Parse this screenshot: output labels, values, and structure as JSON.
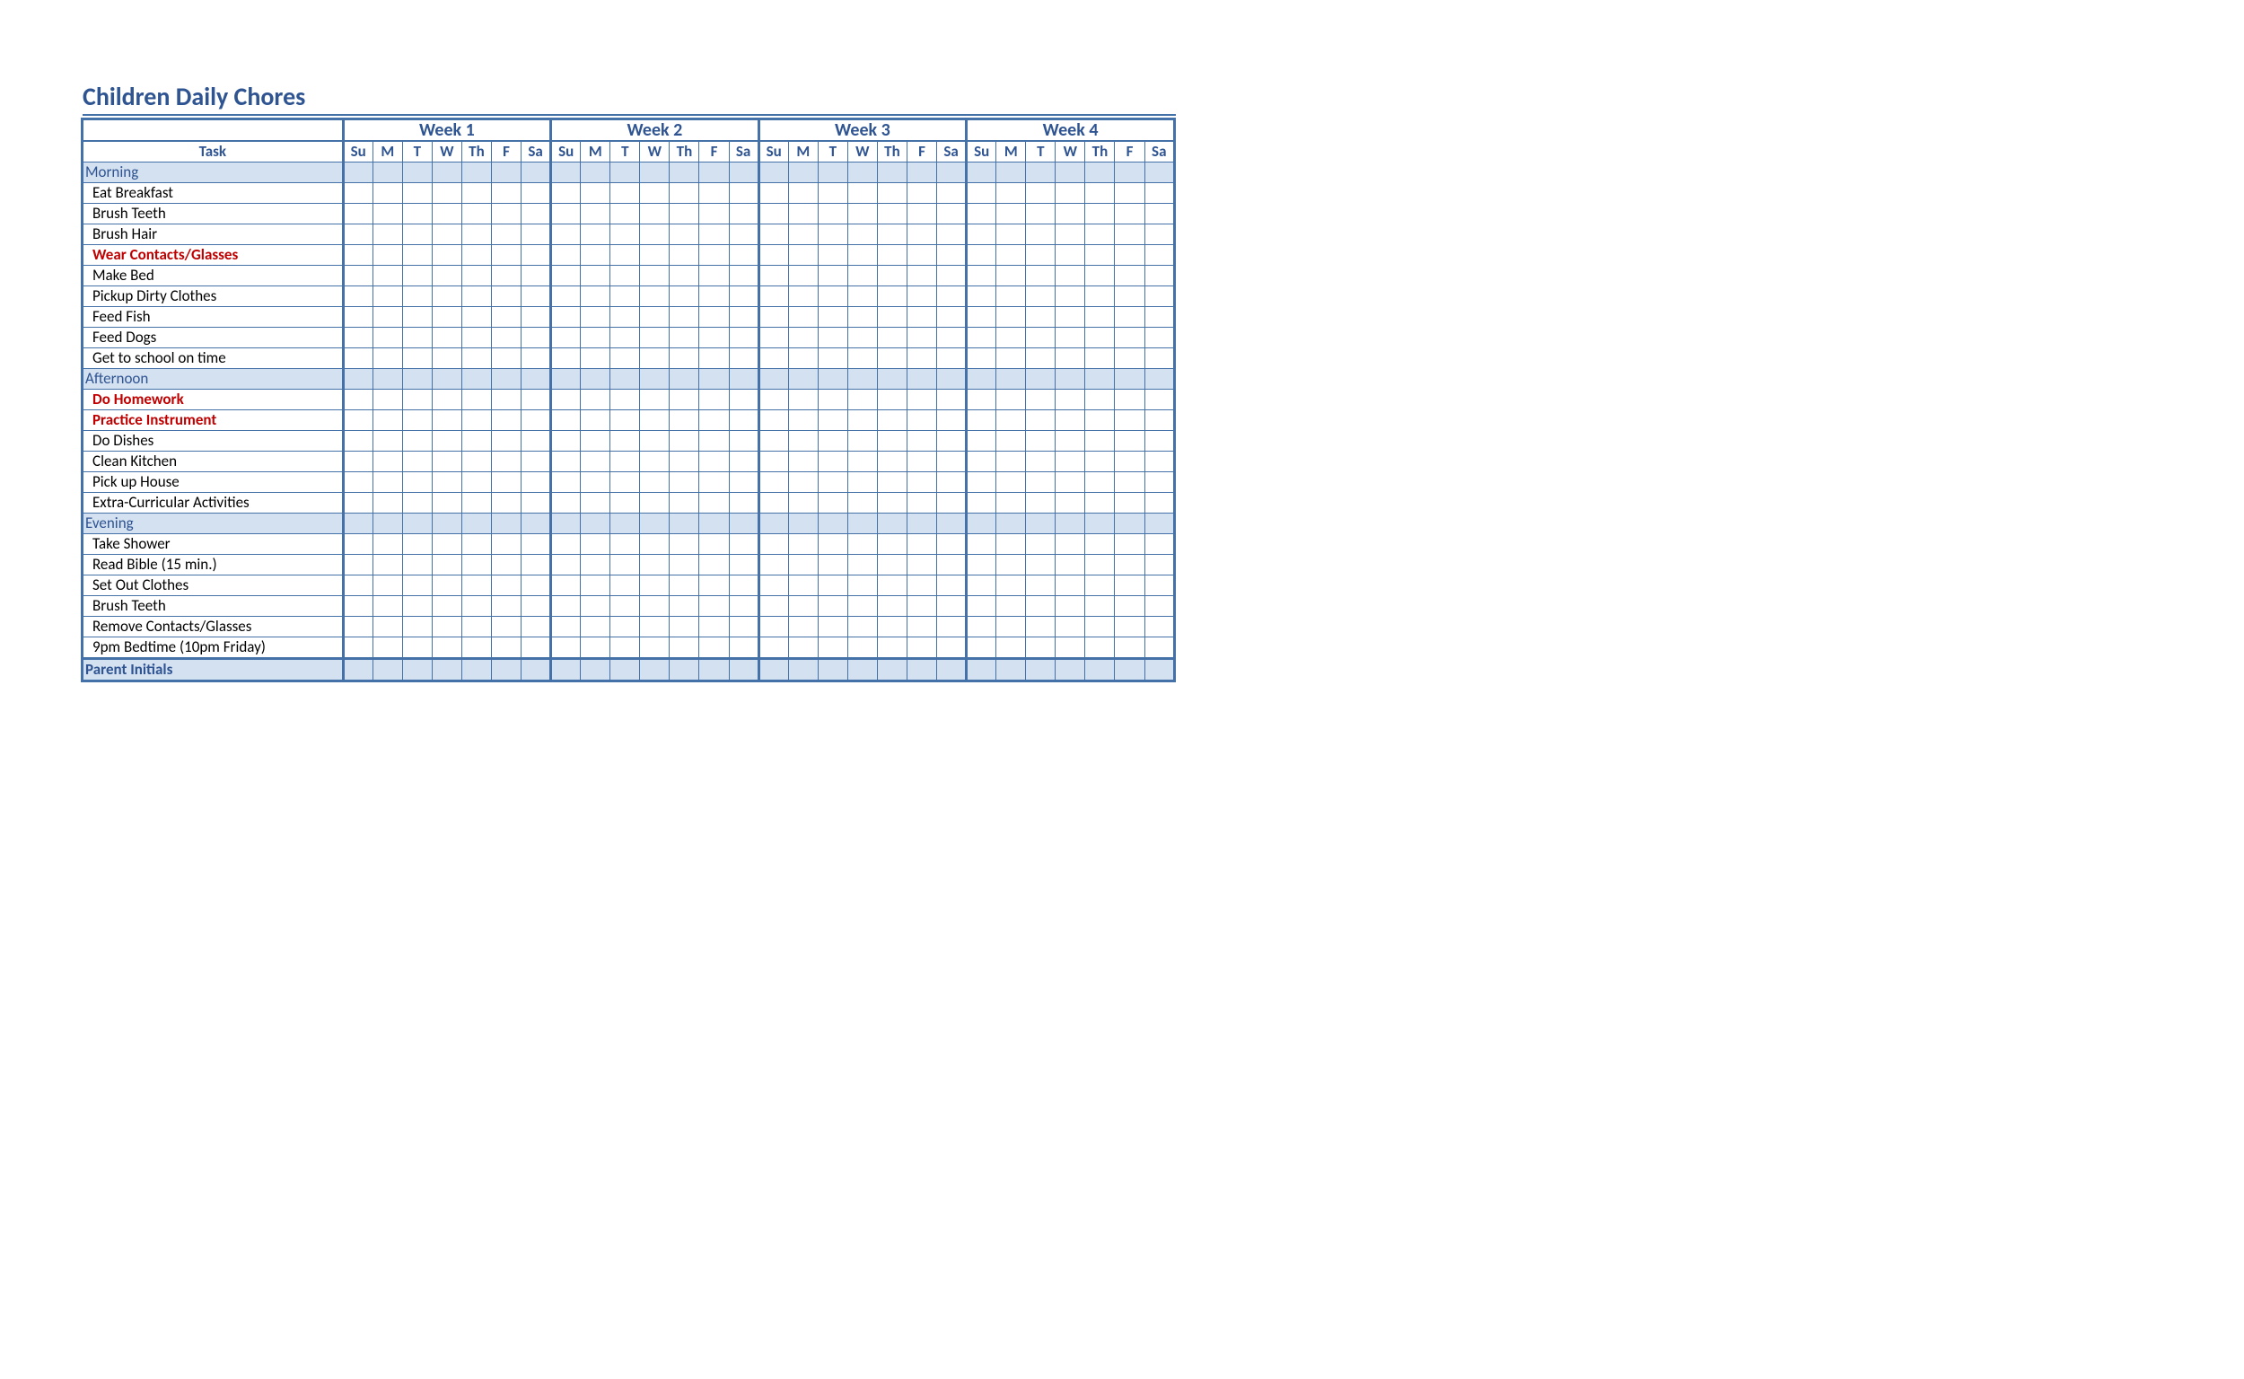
{
  "title": "Children Daily Chores",
  "task_header": "Task",
  "weeks": [
    "Week 1",
    "Week 2",
    "Week 3",
    "Week 4"
  ],
  "days": [
    "Su",
    "M",
    "T",
    "W",
    "Th",
    "F",
    "Sa"
  ],
  "sections": [
    {
      "label": "Morning",
      "tasks": [
        {
          "label": "Eat Breakfast",
          "red": false
        },
        {
          "label": "Brush Teeth",
          "red": false
        },
        {
          "label": "Brush Hair",
          "red": false
        },
        {
          "label": "Wear Contacts/Glasses",
          "red": true
        },
        {
          "label": "Make Bed",
          "red": false
        },
        {
          "label": "Pickup Dirty Clothes",
          "red": false
        },
        {
          "label": "Feed Fish",
          "red": false
        },
        {
          "label": "Feed Dogs",
          "red": false
        },
        {
          "label": "Get to school on time",
          "red": false
        }
      ]
    },
    {
      "label": "Afternoon",
      "tasks": [
        {
          "label": "Do Homework",
          "red": true
        },
        {
          "label": "Practice Instrument",
          "red": true
        },
        {
          "label": "Do Dishes",
          "red": false
        },
        {
          "label": "Clean Kitchen",
          "red": false
        },
        {
          "label": "Pick up House",
          "red": false
        },
        {
          "label": "Extra-Curricular Activities",
          "red": false
        }
      ]
    },
    {
      "label": "Evening",
      "tasks": [
        {
          "label": "Take Shower",
          "red": false
        },
        {
          "label": "Read Bible (15 min.)",
          "red": false
        },
        {
          "label": "Set Out Clothes",
          "red": false
        },
        {
          "label": "Brush Teeth",
          "red": false
        },
        {
          "label": "Remove Contacts/Glasses",
          "red": false
        },
        {
          "label": "9pm Bedtime (10pm Friday)",
          "red": false
        }
      ]
    }
  ],
  "footer_label": "Parent Initials"
}
